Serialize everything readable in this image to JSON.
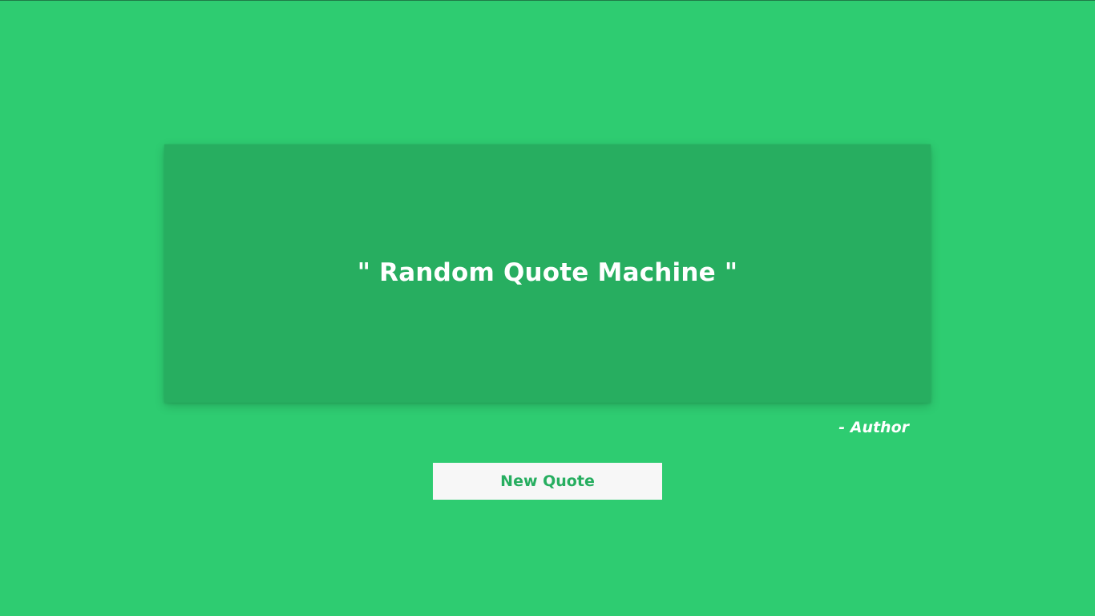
{
  "quote": {
    "text": "\" Random Quote Machine \"",
    "author": "- Author"
  },
  "controls": {
    "new_quote_label": "New Quote"
  },
  "colors": {
    "background": "#2ecc71",
    "card": "#27ae60",
    "button_background": "#f7f7f7",
    "button_text": "#27ae60",
    "text": "#ffffff"
  }
}
